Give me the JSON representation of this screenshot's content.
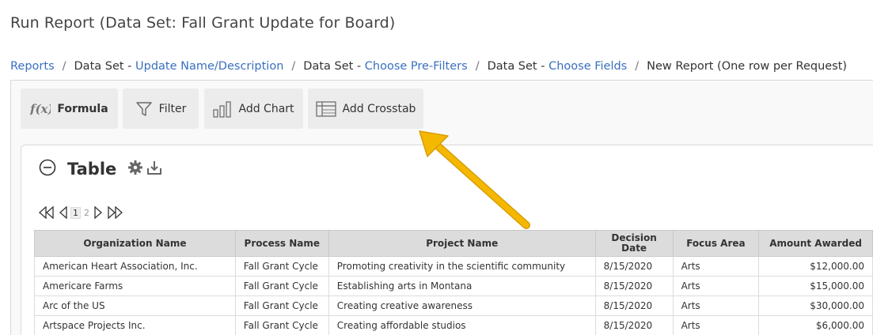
{
  "page": {
    "title": "Run Report (Data Set: Fall Grant Update for Board)"
  },
  "breadcrumb": {
    "items": [
      {
        "prefix": "",
        "link": "Reports"
      },
      {
        "prefix": "Data Set - ",
        "link": "Update Name/Description"
      },
      {
        "prefix": "Data Set - ",
        "link": "Choose Pre-Filters"
      },
      {
        "prefix": "Data Set - ",
        "link": "Choose Fields"
      },
      {
        "prefix": "New Report (One row per Request)",
        "link": ""
      }
    ]
  },
  "toolbar": {
    "formula_label": "Formula",
    "filter_label": "Filter",
    "chart_label": "Add Chart",
    "crosstab_label": "Add Crosstab"
  },
  "table_section": {
    "title": "Table"
  },
  "pager": {
    "pages": [
      "1",
      "2"
    ],
    "current": "1"
  },
  "table": {
    "columns": [
      "Organization Name",
      "Process Name",
      "Project Name",
      "Decision Date",
      "Focus Area",
      "Amount Awarded"
    ],
    "rows": [
      [
        "American Heart Association, Inc.",
        "Fall Grant Cycle",
        "Promoting creativity in the scientific community",
        "8/15/2020",
        "Arts",
        "$12,000.00"
      ],
      [
        "Americare Farms",
        "Fall Grant Cycle",
        "Establishing arts in Montana",
        "8/15/2020",
        "Arts",
        "$15,000.00"
      ],
      [
        "Arc of the US",
        "Fall Grant Cycle",
        "Creating creative awareness",
        "8/15/2020",
        "Arts",
        "$30,000.00"
      ],
      [
        "Artspace Projects Inc.",
        "Fall Grant Cycle",
        "Creating affordable studios",
        "8/15/2020",
        "Arts",
        "$6,000.00"
      ]
    ]
  },
  "colors": {
    "link": "#3a6fbf",
    "arrow": "#f5b800",
    "button_bg": "#ececec",
    "header_bg": "#dcdcdc"
  }
}
